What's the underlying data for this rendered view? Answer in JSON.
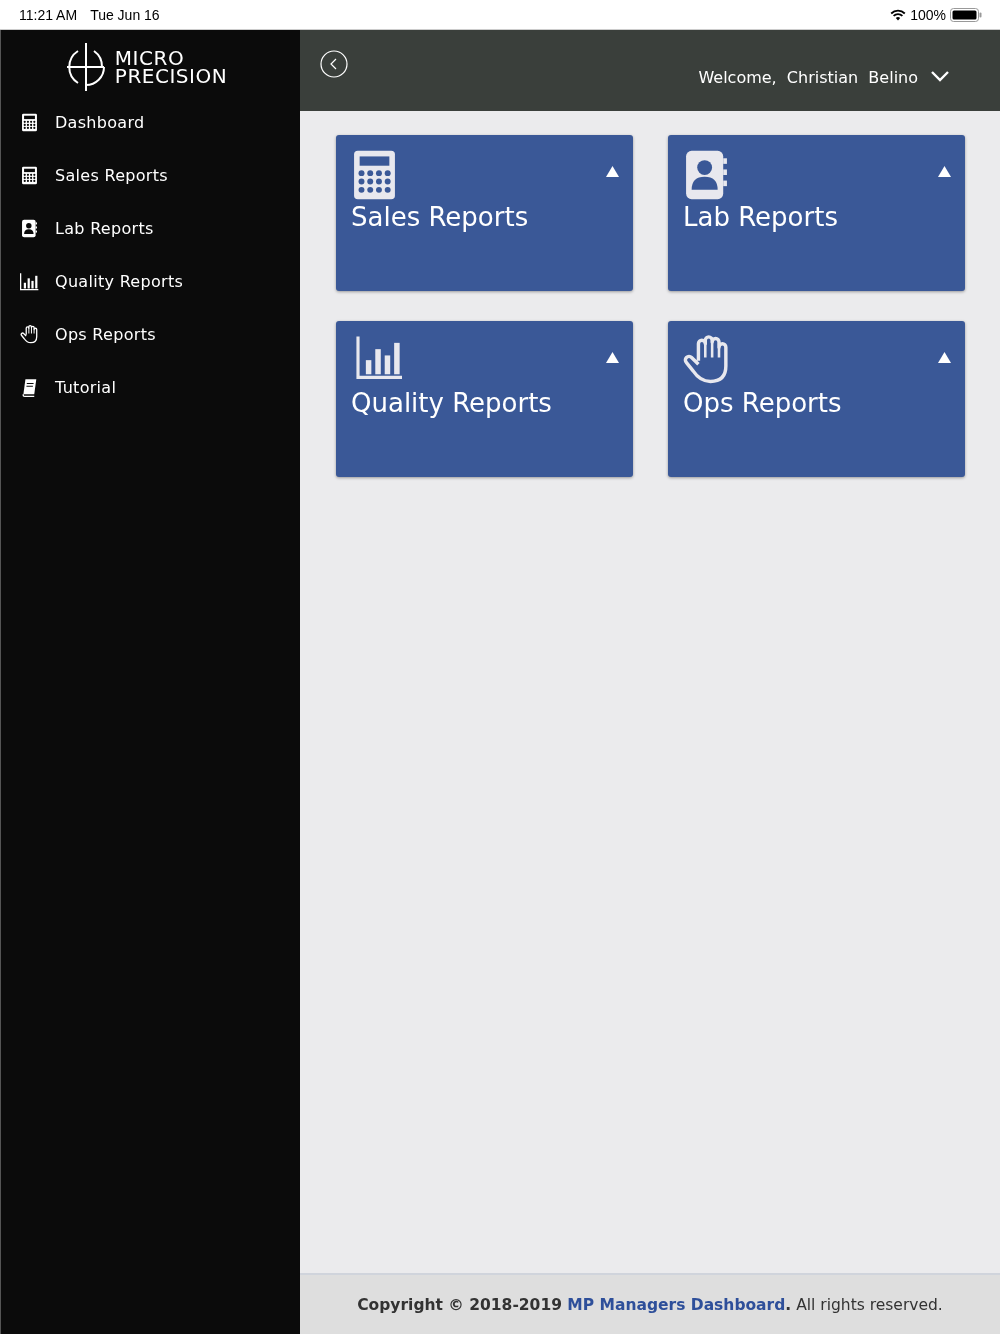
{
  "status_bar": {
    "time": "11:21 AM",
    "date": "Tue Jun 16",
    "battery": "100%"
  },
  "sidebar": {
    "logo": [
      "MICRO",
      "PRECISION"
    ],
    "items": [
      {
        "label": "Dashboard",
        "selected": false
      },
      {
        "label": "Sales Reports",
        "selected": false
      },
      {
        "label": "Lab Reports",
        "selected": false
      },
      {
        "label": "Quality Reports",
        "selected": false
      },
      {
        "label": "Ops Reports",
        "selected": false
      },
      {
        "label": "Tutorial",
        "selected": false
      }
    ]
  },
  "header": {
    "welcome": "Welcome,  Christian  Belino"
  },
  "cards": [
    {
      "title": "Sales Reports",
      "expanded": true
    },
    {
      "title": "Lab Reports",
      "expanded": true
    },
    {
      "title": "Quality Reports",
      "expanded": true
    },
    {
      "title": "Ops Reports",
      "expanded": true
    }
  ],
  "footer": {
    "prefix": "Copyright © 2018-2019 ",
    "link": "MP Managers Dashboard",
    "suffix": "**.** All rights reserved."
  }
}
